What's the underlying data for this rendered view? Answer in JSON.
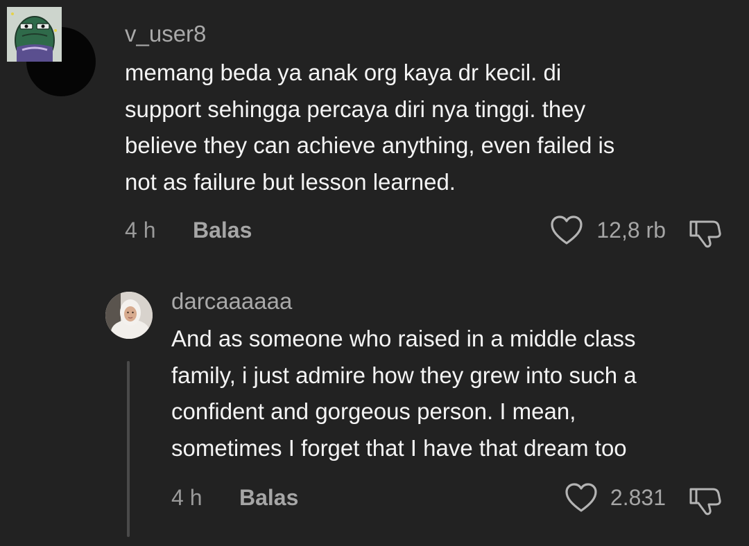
{
  "comments": [
    {
      "username": "v_user8",
      "lines": [
        "memang beda ya anak org kaya dr kecil. di",
        "support sehingga percaya diri nya tinggi. they",
        "believe they can achieve anything, even failed is",
        "not as failure but lesson learned."
      ],
      "time": "4 h",
      "reply_label": "Balas",
      "likes": "12,8 rb",
      "avatar_icon": "cartoon-sticker-avatar"
    },
    {
      "username": "darcaaaaaa",
      "lines": [
        "And as someone who raised in a middle class",
        "family, i just admire how they grew into such a",
        "confident and gorgeous person. I mean,",
        "sometimes I forget that I have that dream too"
      ],
      "time": "4 h",
      "reply_label": "Balas",
      "likes": "2.831",
      "avatar_icon": "profile-photo-avatar"
    }
  ],
  "icons": {
    "like": "heart-outline-icon",
    "dislike": "thumbs-down-outline-icon"
  },
  "colors": {
    "background": "#222222",
    "text": "#f4f4f4",
    "muted": "#a6a6a6",
    "thread_line": "#4a4a4a"
  }
}
